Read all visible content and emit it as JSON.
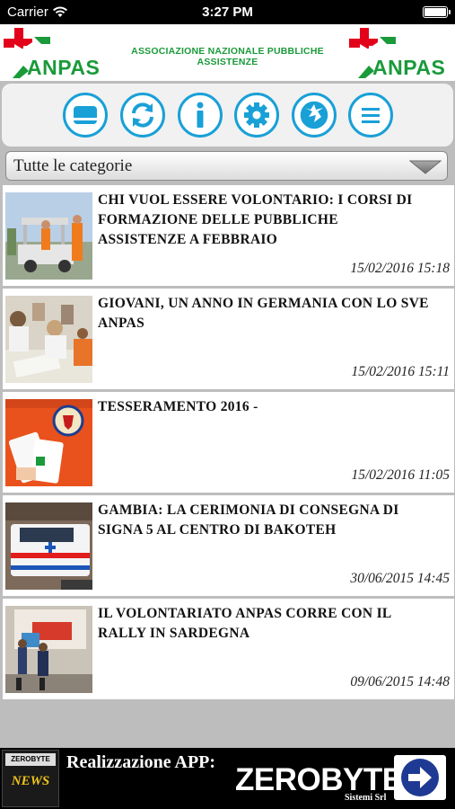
{
  "status_bar": {
    "carrier": "Carrier",
    "time": "3:27 PM"
  },
  "header": {
    "logo_left_text": "ANPAS",
    "title": "ASSOCIAZIONE NAZIONALE PUBBLICHE ASSISTENZE",
    "logo_right_text": "ANPAS",
    "brand_color": "#1a9a3a",
    "accent_red": "#e2001a"
  },
  "toolbar": {
    "accent_color": "#19a0d7",
    "buttons": [
      {
        "icon": "card-icon"
      },
      {
        "icon": "refresh-icon"
      },
      {
        "icon": "info-icon"
      },
      {
        "icon": "gear-icon"
      },
      {
        "icon": "anpas-emblem-icon"
      },
      {
        "icon": "menu-icon"
      }
    ]
  },
  "category_filter": {
    "selected": "Tutte le categorie"
  },
  "news": [
    {
      "title": "CHI VUOL ESSERE VOLONTARIO: I CORSI DI FORMAZIONE DELLE PUBBLICHE ASSISTENZE A FEBBRAIO",
      "date": "15/02/2016 15:18"
    },
    {
      "title": "GIOVANI, UN ANNO IN GERMANIA CON LO SVE ANPAS",
      "date": "15/02/2016 15:11"
    },
    {
      "title": "TESSERAMENTO 2016 -",
      "date": "15/02/2016 11:05"
    },
    {
      "title": "GAMBIA: LA CERIMONIA DI CONSEGNA DI SIGNA 5 AL CENTRO DI BAKOTEH",
      "date": "30/06/2015 14:45"
    },
    {
      "title": "IL VOLONTARIATO ANPAS CORRE CON IL RALLY IN SARDEGNA",
      "date": "09/06/2015 14:48"
    }
  ],
  "footer": {
    "label": "Realizzazione APP:",
    "brand": "ZEROBYTE",
    "brand_sub": "Sistemi Srl",
    "badge_top": "ZEROBYTE",
    "badge_bottom": "NEWS"
  }
}
